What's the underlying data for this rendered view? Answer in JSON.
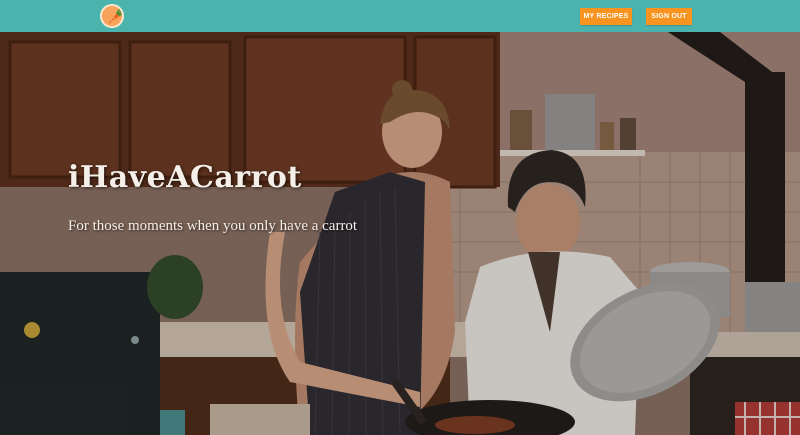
{
  "app": {
    "logo_icon": "carrot-icon",
    "colors": {
      "navbar": "#4bb3ad",
      "button": "#f7931e",
      "logo": "#f7a35c"
    }
  },
  "nav": {
    "my_recipes_label": "MY RECIPES",
    "sign_out_label": "SIGN OUT"
  },
  "hero": {
    "title": "iHaveACarrot",
    "subtitle": "For those moments when you only have a carrot"
  }
}
